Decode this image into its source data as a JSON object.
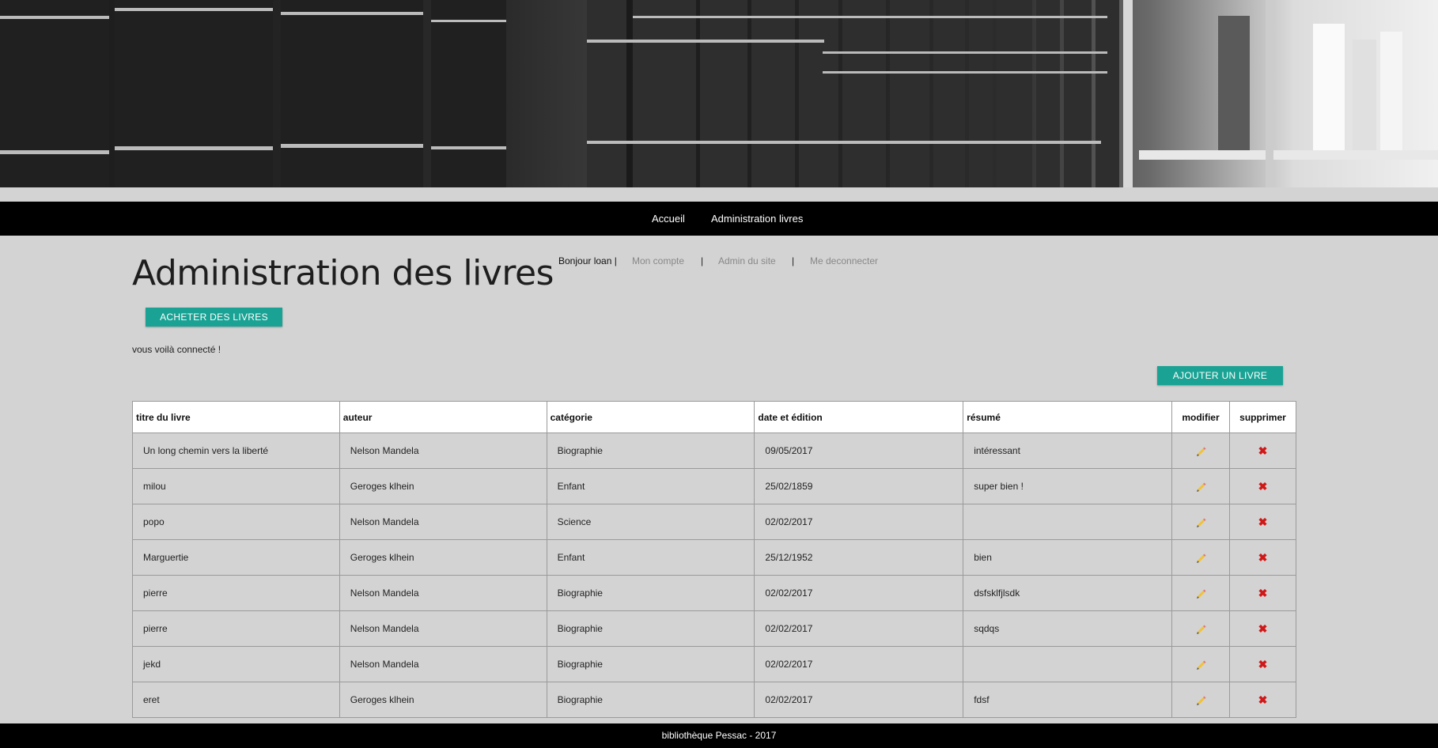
{
  "nav": {
    "home": "Accueil",
    "admin": "Administration livres"
  },
  "page": {
    "title": "Administration des livres",
    "connected_msg": "vous voilà connecté !"
  },
  "user": {
    "greeting": "Bonjour loan |",
    "account": "Mon compte",
    "site_admin": "Admin du site",
    "logout": "Me deconnecter",
    "separator": "|"
  },
  "buttons": {
    "buy": "ACHETER DES LIVRES",
    "add": "AJOUTER UN LIVRE"
  },
  "table": {
    "headers": [
      "titre du livre",
      "auteur",
      "catégorie",
      "date et édition",
      "résumé",
      "modifier",
      "supprimer"
    ],
    "rows": [
      [
        "Un long chemin vers la liberté",
        "Nelson Mandela",
        "Biographie",
        "09/05/2017",
        "intéressant"
      ],
      [
        "milou",
        "Geroges klhein",
        "Enfant",
        "25/02/1859",
        "super bien !"
      ],
      [
        "popo",
        "Nelson Mandela",
        "Science",
        "02/02/2017",
        ""
      ],
      [
        "Marguertie",
        "Geroges klhein",
        "Enfant",
        "25/12/1952",
        "bien"
      ],
      [
        "pierre",
        "Nelson Mandela",
        "Biographie",
        "02/02/2017",
        "dsfsklfjlsdk"
      ],
      [
        "pierre",
        "Nelson Mandela",
        "Biographie",
        "02/02/2017",
        "sqdqs"
      ],
      [
        "jekd",
        "Nelson Mandela",
        "Biographie",
        "02/02/2017",
        ""
      ],
      [
        "eret",
        "Geroges klhein",
        "Biographie",
        "02/02/2017",
        "fdsf"
      ]
    ]
  },
  "footer": {
    "text": "bibliothèque Pessac - 2017"
  },
  "colors": {
    "accent": "#1aa394",
    "nav_bg": "#000000",
    "page_bg": "#d3d3d3",
    "delete": "#d01818"
  }
}
